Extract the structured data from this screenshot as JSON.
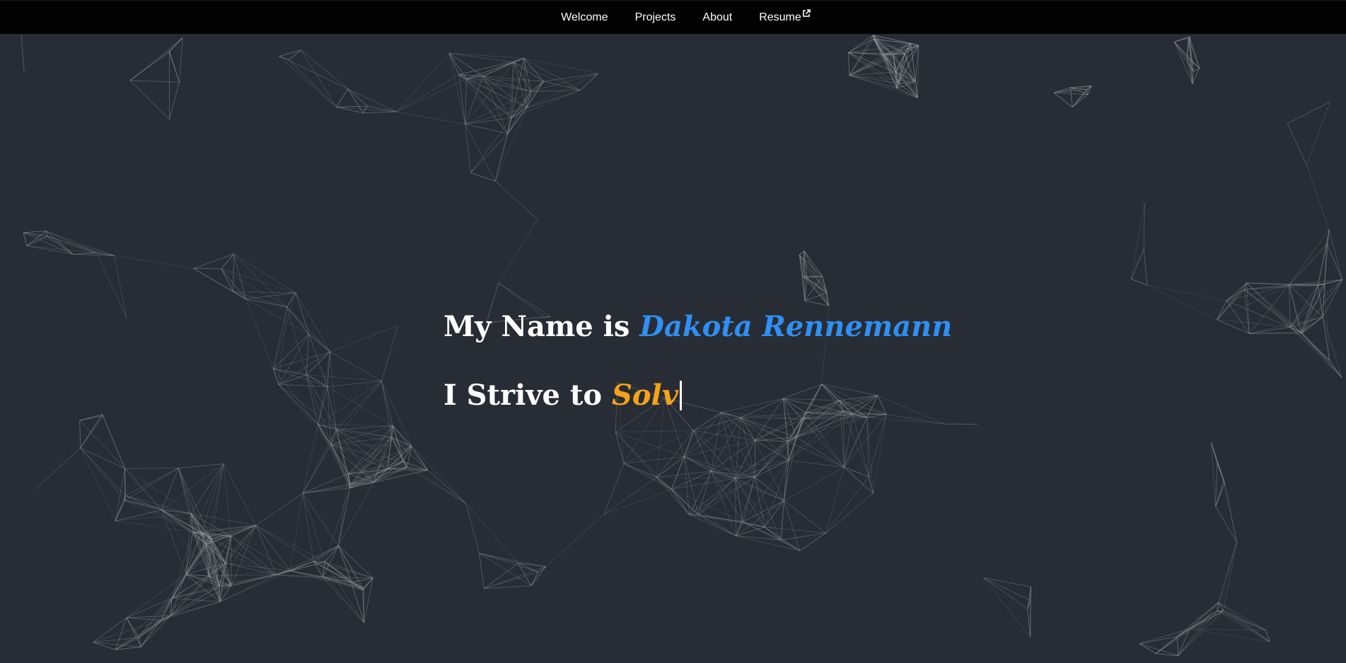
{
  "nav": {
    "items": [
      {
        "label": "Welcome"
      },
      {
        "label": "Projects"
      },
      {
        "label": "About"
      },
      {
        "label": "Resume",
        "icon": "external-link-icon"
      }
    ]
  },
  "hero": {
    "line1_prefix": "My Name is ",
    "name": "Dakota Rennemann",
    "line2_prefix": "I Strive to ",
    "typed_word": "Solv"
  },
  "colors": {
    "background": "#282c34",
    "navbar": "#020202",
    "name_accent": "#2f8ff2",
    "typed_accent": "#f5a21c",
    "network_lines": "#9a9da3"
  }
}
